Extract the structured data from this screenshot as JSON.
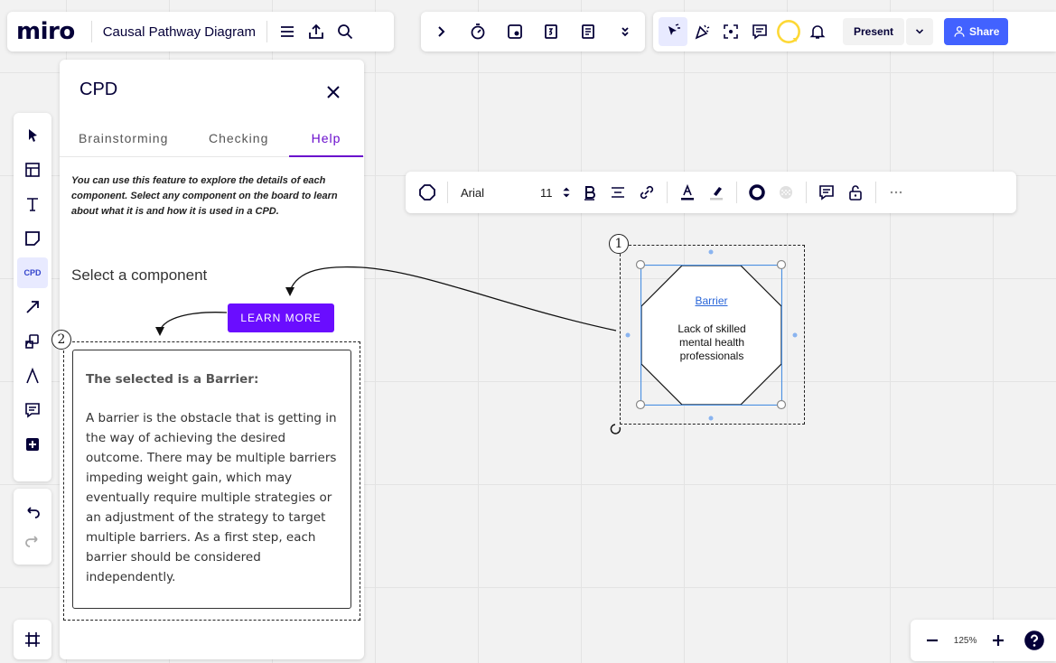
{
  "app": {
    "logo": "miro",
    "board_title": "Causal Pathway Diagram"
  },
  "top_right": {
    "present_label": "Present",
    "share_label": "Share"
  },
  "left_toolbar": {
    "cpd_label": "CPD"
  },
  "panel": {
    "title": "CPD",
    "tabs": [
      {
        "label": "Brainstorming"
      },
      {
        "label": "Checking"
      },
      {
        "label": "Help",
        "active": true
      }
    ],
    "intro": "You can use this feature to explore the details of each component. Select any component on the board to learn about what it is and how it is used in a CPD.",
    "select_label": "Select a component",
    "learn_more_label": "LEARN MORE",
    "info_heading": "The selected is a Barrier:",
    "info_body": "A barrier is the obstacle that is getting in the way of achieving the desired outcome. There may be multiple barriers impeding weight gain, which may eventually require multiple strategies or an adjustment of the strategy to target multiple barriers. As a first step, each barrier should be considered independently."
  },
  "format_toolbar": {
    "font": "Arial",
    "font_size": "11"
  },
  "shape": {
    "title": "Barrier",
    "text": "Lack of skilled mental health professionals"
  },
  "annotations": {
    "one": "1",
    "two": "2"
  },
  "zoom": {
    "level": "125%"
  },
  "colors": {
    "accent": "#6a0dff",
    "share": "#4262ff",
    "selection": "#4a90e2"
  }
}
